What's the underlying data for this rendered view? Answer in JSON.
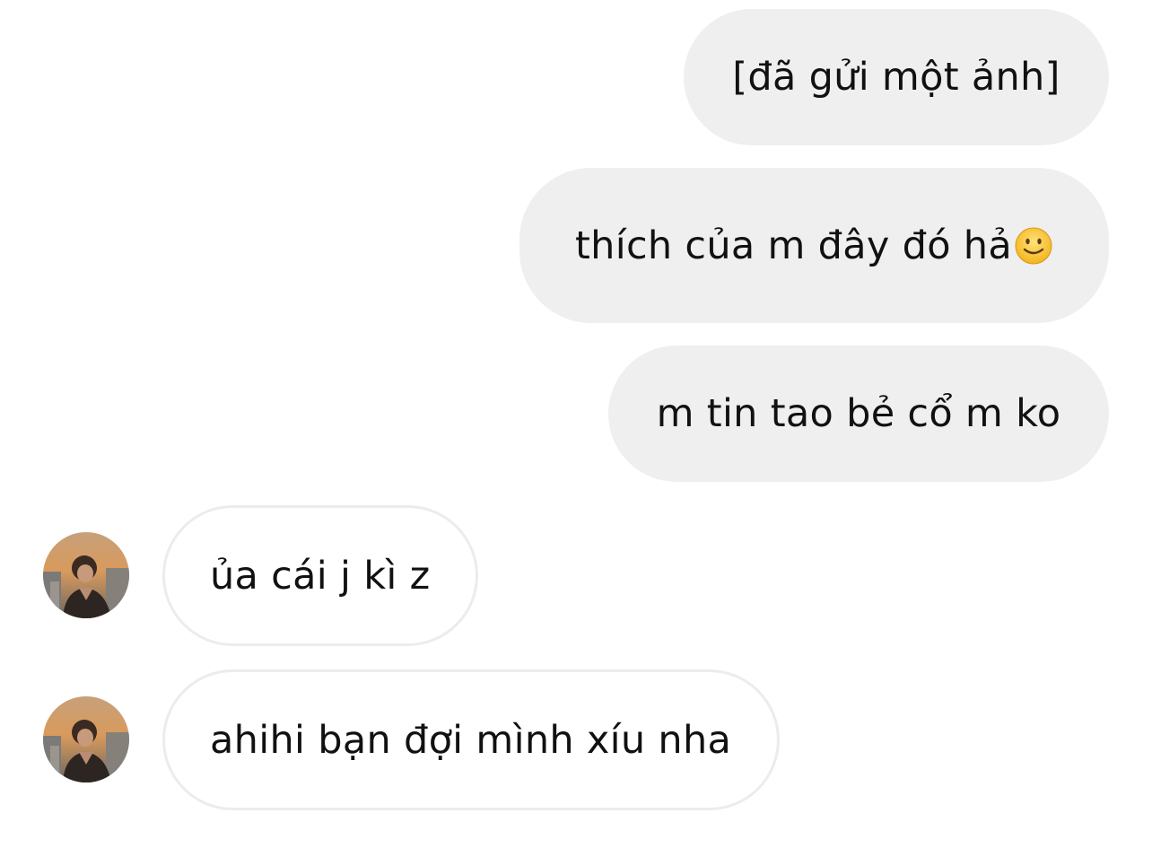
{
  "messages": {
    "sent": [
      {
        "text": "[đã gửi một ảnh]"
      },
      {
        "text": "thích của m đây đó hả",
        "emoji": "slightly-smiling-face-icon"
      },
      {
        "text": "m tin tao bẻ cổ m ko"
      }
    ],
    "received": [
      {
        "text": "ủa cái j kì z"
      },
      {
        "text": "ahihi bạn đợi mình xíu nha"
      }
    ]
  },
  "colors": {
    "sent_bubble": "#efefef",
    "received_bubble_border": "#ececec",
    "text": "#111111"
  }
}
